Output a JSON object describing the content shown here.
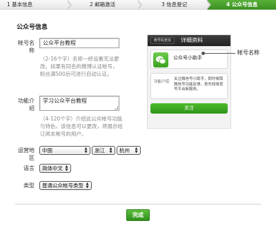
{
  "steps": [
    {
      "label": "1 基本信息",
      "active": false
    },
    {
      "label": "2 邮箱激活",
      "active": false
    },
    {
      "label": "3 信息登记",
      "active": false
    },
    {
      "label": "4 公众号信息",
      "active": true
    }
  ],
  "section_title": "公众号信息",
  "form": {
    "account_name": {
      "label": "帐号名称",
      "value": "公众平台教程",
      "hint": "（2-16个字）名称一经设置无法更改。如果有同名的微博认证帐号，粉丝满500后可进行自动认证。"
    },
    "intro": {
      "label": "功能介绍",
      "value": "学习公众平台教程",
      "hint": "（4-120个字）介绍此公众帐号功能与特色，该信息可以更改，将展示给订阅本帐号的用户。"
    },
    "location": {
      "label": "运营地区",
      "country": "中国",
      "province": "浙江",
      "city": "杭州"
    },
    "language": {
      "label": "语言",
      "value": "简体中文"
    },
    "type": {
      "label": "类型",
      "value": "普通公众帐号类型"
    }
  },
  "preview": {
    "back_label": "微号码查找",
    "header_title": "详细资料",
    "account_name": "公众号小助手",
    "info_label": "功能介绍",
    "info_text": "关注微信号小助手，即时收取微信号功能反馈，抢先知晓官号平台新服务。",
    "follow_label": "关注",
    "annotation": "帐号名称"
  },
  "done_label": "完成",
  "colors": {
    "accent": "#44a526",
    "hint": "#888888"
  }
}
